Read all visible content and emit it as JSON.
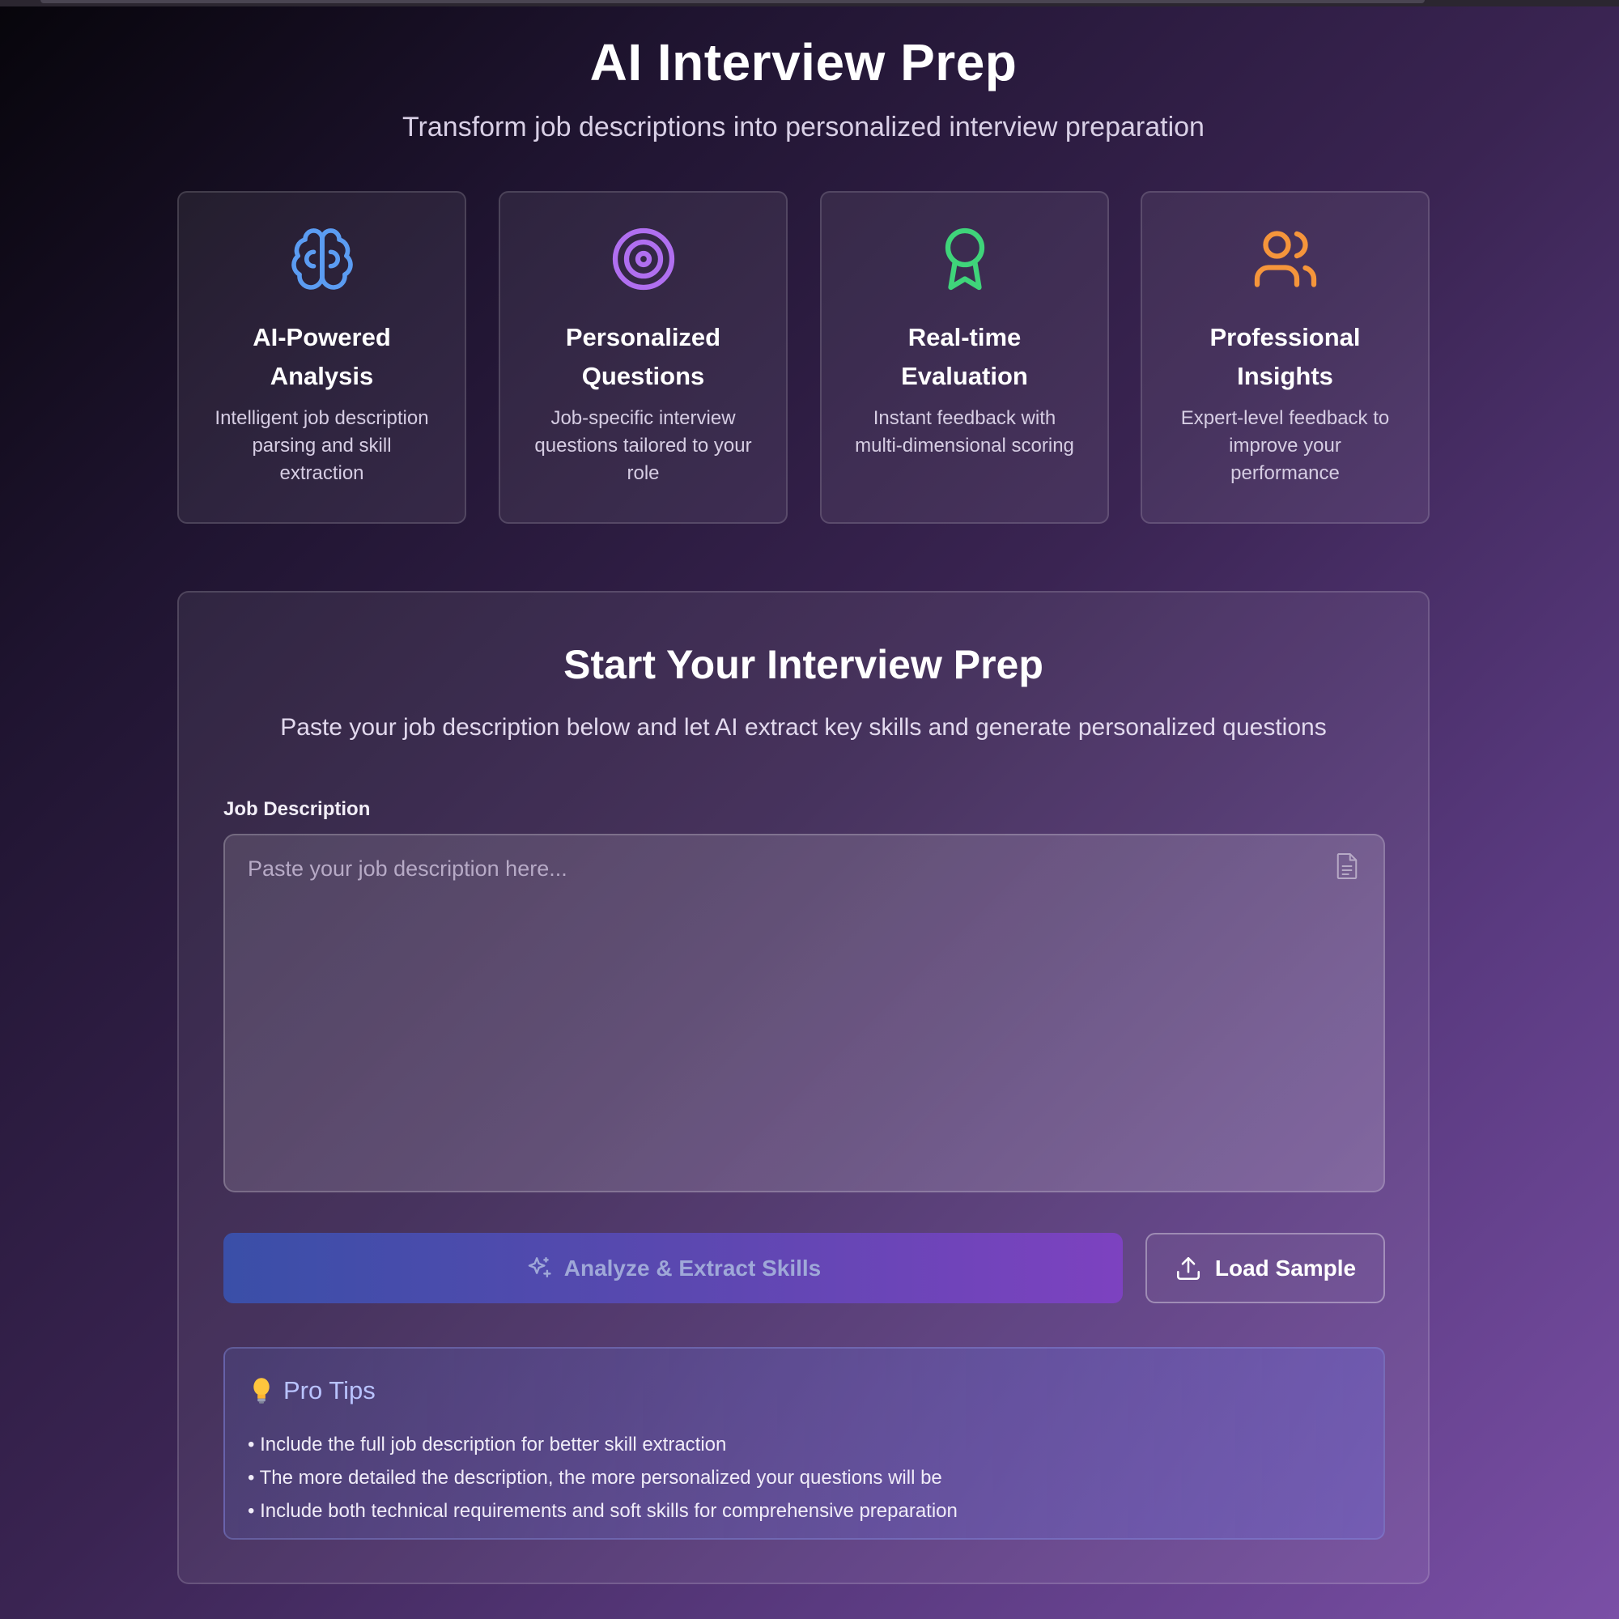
{
  "header": {
    "title": "AI Interview Prep",
    "subtitle": "Transform job descriptions into personalized interview preparation"
  },
  "features": [
    {
      "icon": "brain-icon",
      "color": "#5b9cf2",
      "title": "AI-Powered Analysis",
      "description": "Intelligent job description parsing and skill extraction"
    },
    {
      "icon": "target-icon",
      "color": "#b06ff0",
      "title": "Personalized Questions",
      "description": "Job-specific interview questions tailored to your role"
    },
    {
      "icon": "award-icon",
      "color": "#3fd47a",
      "title": "Real-time Evaluation",
      "description": "Instant feedback with multi-dimensional scoring"
    },
    {
      "icon": "users-icon",
      "color": "#f5953b",
      "title": "Professional Insights",
      "description": "Expert-level feedback to improve your performance"
    }
  ],
  "main": {
    "title": "Start Your Interview Prep",
    "subtitle": "Paste your job description below and let AI extract key skills and generate personalized questions",
    "jd_label": "Job Description",
    "jd_placeholder": "Paste your job description here...",
    "jd_value": "",
    "analyze_label": "Analyze & Extract Skills",
    "sample_label": "Load Sample"
  },
  "tips": {
    "title": "Pro Tips",
    "items": [
      "Include the full job description for better skill extraction",
      "The more detailed the description, the more personalized your questions will be",
      "Include both technical requirements and soft skills for comprehensive preparation"
    ]
  }
}
